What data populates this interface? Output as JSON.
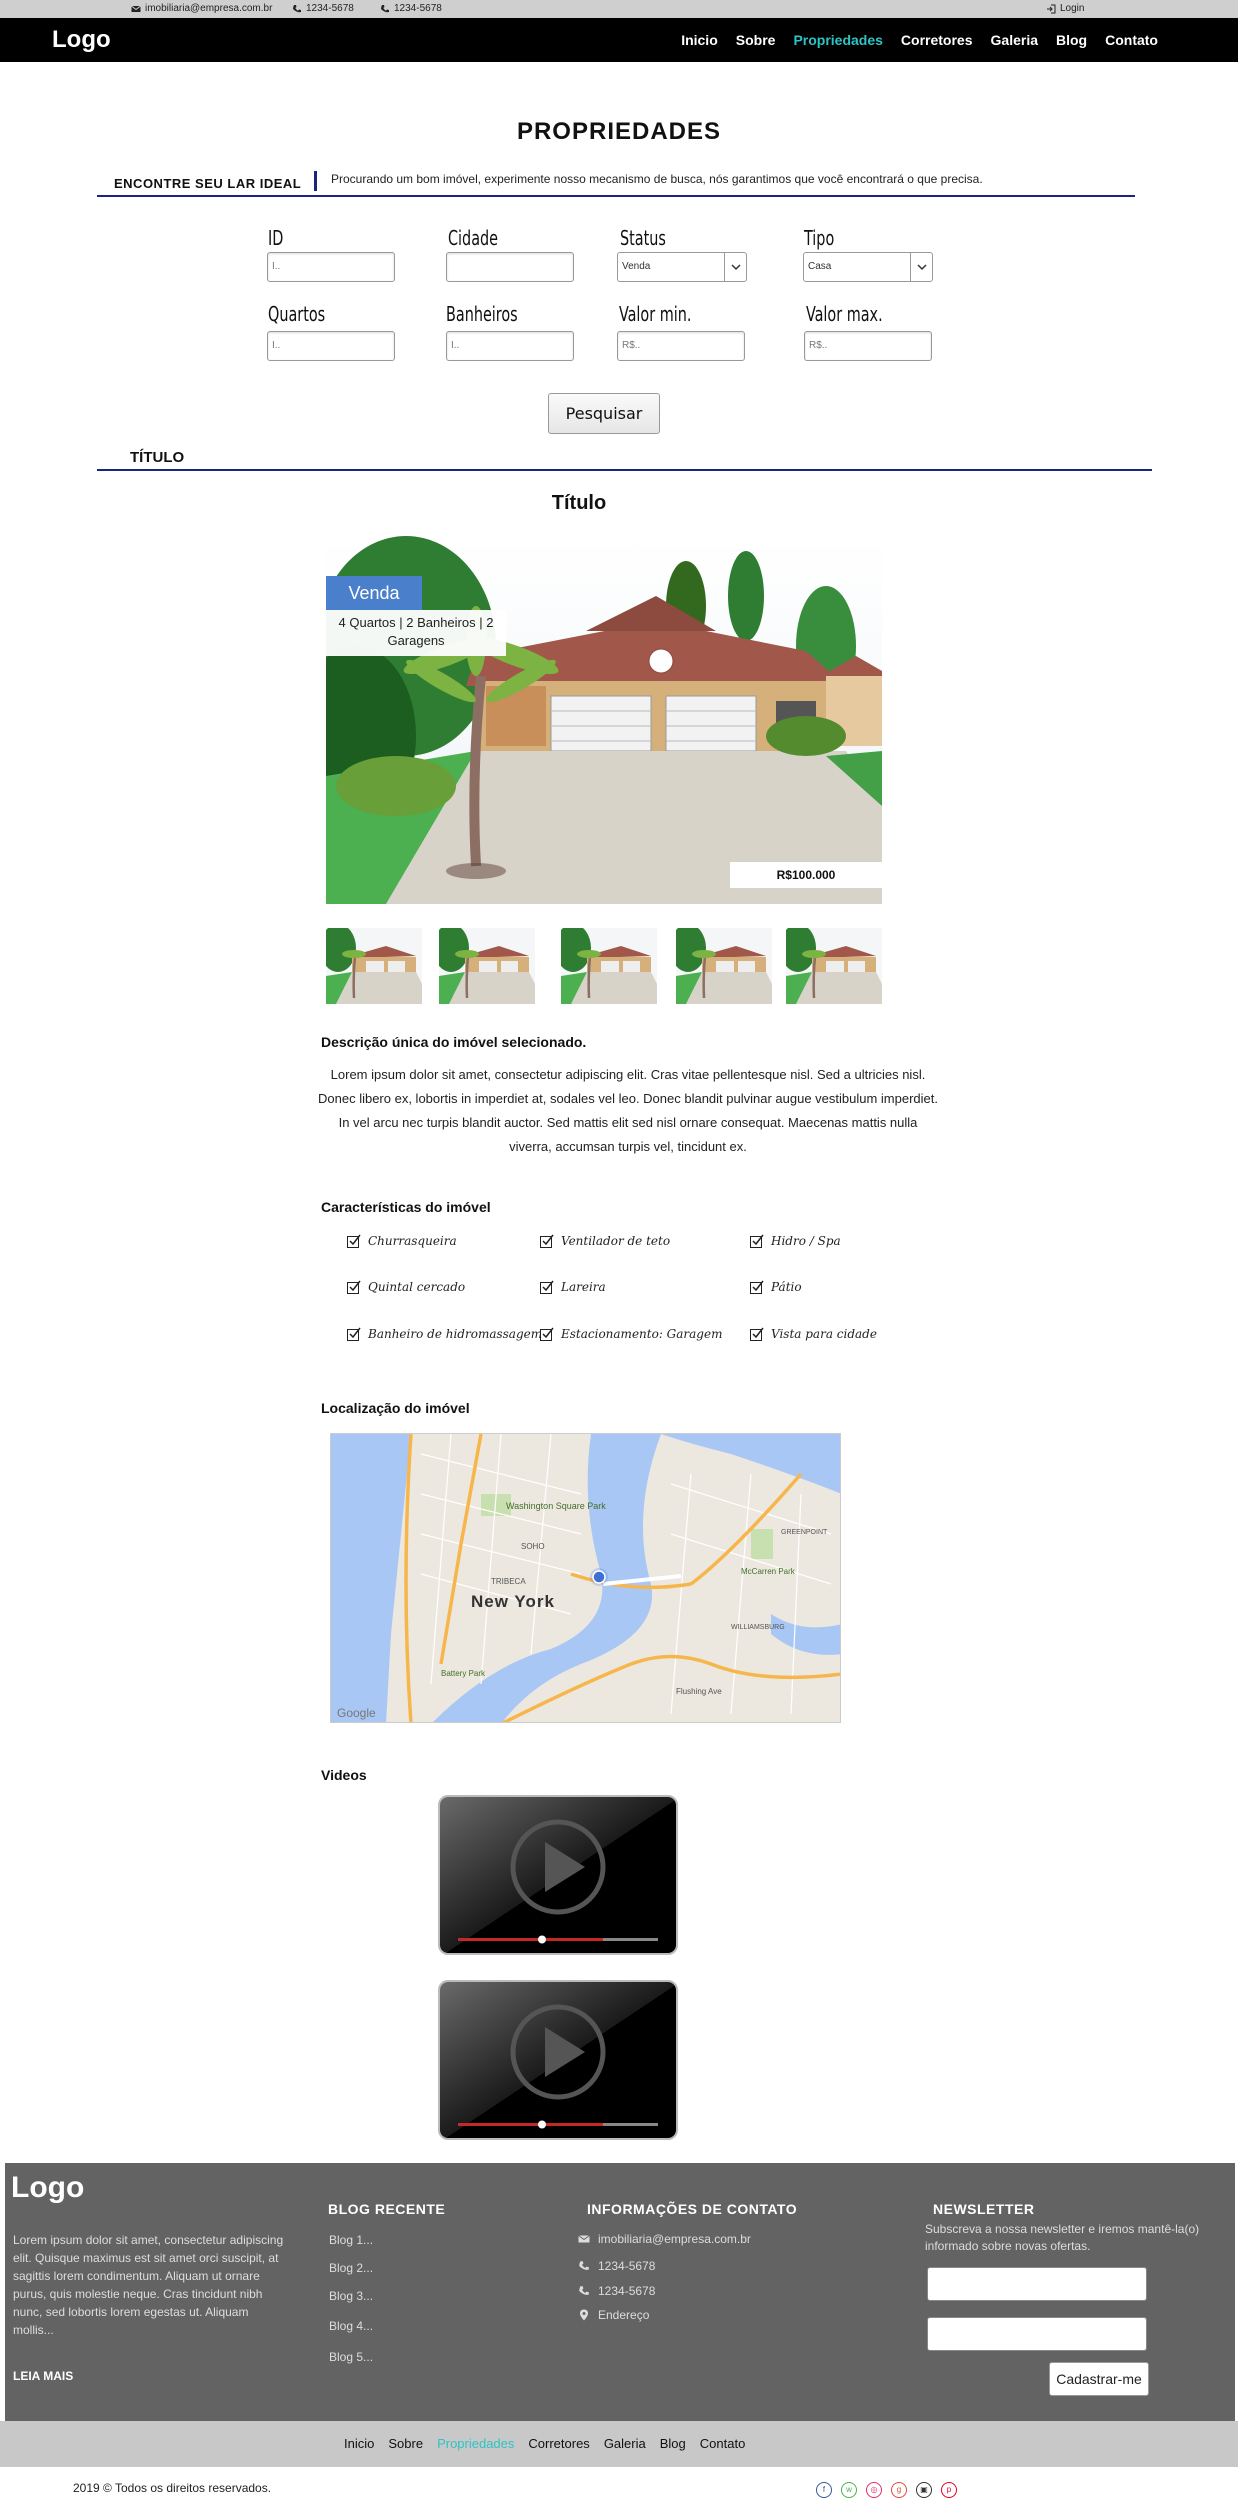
{
  "topbar": {
    "email": "imobiliaria@empresa.com.br",
    "phone1": "1234-5678",
    "phone2": "1234-5678",
    "login": "Login"
  },
  "header": {
    "logo": "Logo",
    "nav": [
      "Inicio",
      "Sobre",
      "Propriedades",
      "Corretores",
      "Galeria",
      "Blog",
      "Contato"
    ],
    "active_nav": "Propriedades"
  },
  "page": {
    "title": "PROPRIEDADES",
    "finder_label": "ENCONTRE SEU LAR IDEAL",
    "finder_text": "Procurando um bom imóvel, experimente nosso mecanismo de busca, nós garantimos que você encontrará o que precisa."
  },
  "search": {
    "id_label": "ID",
    "id_placeholder": "I..",
    "cidade_label": "Cidade",
    "cidade_placeholder": "",
    "status_label": "Status",
    "status_value": "Venda",
    "tipo_label": "Tipo",
    "tipo_value": "Casa",
    "quartos_label": "Quartos",
    "quartos_placeholder": "I..",
    "banheiros_label": "Banheiros",
    "banheiros_placeholder": "I..",
    "valor_min_label": "Valor min.",
    "valor_min_placeholder": "R$..",
    "valor_max_label": "Valor max.",
    "valor_max_placeholder": "R$..",
    "button": "Pesquisar"
  },
  "listing": {
    "section_label": "TÍTULO",
    "title": "Título",
    "status_badge": "Venda",
    "features": "4 Quartos | 2 Banheiros | 2 Garagens",
    "price": "R$100.000",
    "desc_title": "Descrição única do imóvel selecionado.",
    "desc_text": "Lorem ipsum dolor sit amet, consectetur adipiscing elit. Cras vitae pellentesque nisl. Sed a ultricies nisl. Donec libero ex, lobortis in imperdiet at, sodales vel leo. Donec blandit pulvinar augue vestibulum imperdiet. In vel arcu nec turpis blandit auctor. Sed mattis elit sed nisl ornare consequat. Maecenas mattis nulla viverra, accumsan turpis vel, tincidunt ex.",
    "characteristics_title": "Características do imóvel",
    "characteristics": [
      "Churrasqueira",
      "Ventilador de teto",
      "Hidro / Spa",
      "Quintal cercado",
      "Lareira",
      "Pátio",
      "Banheiro de hidromassagem",
      "Estacionamento: Garagem",
      "Vista para cidade"
    ],
    "location_title": "Localização do imóvel",
    "map_labels": {
      "city": "New York",
      "park": "Washington Square Park",
      "soho": "SOHO",
      "tribeca": "TRIBECA",
      "battery": "Battery Park",
      "mccarren": "McCarren Park",
      "williamsburg": "WILLIAMSBURG",
      "greenpoint": "GREENPOINT",
      "flushing": "Flushing Ave",
      "google": "Google"
    },
    "videos_title": "Videos"
  },
  "footer": {
    "logo": "Logo",
    "about": "Lorem ipsum dolor sit amet, consectetur adipiscing elit. Quisque maximus est sit amet orci suscipit, at sagittis lorem condimentum. Aliquam ut ornare purus, quis molestie neque. Cras tincidunt nibh nunc, sed lobortis lorem egestas ut. Aliquam mollis...",
    "read_more": "LEIA MAIS",
    "blog_heading": "BLOG RECENTE",
    "blog_links": [
      "Blog 1...",
      "Blog 2...",
      "Blog 3...",
      "Blog 4...",
      "Blog 5..."
    ],
    "contact_heading": "INFORMAÇÕES DE CONTATO",
    "contact_email": "imobiliaria@empresa.com.br",
    "contact_phone1": "1234-5678",
    "contact_phone2": "1234-5678",
    "contact_address": "Endereço",
    "newsletter_heading": "NEWSLETTER",
    "newsletter_text": "Subscreva a nossa newsletter e iremos mantê-la(o) informado sobre novas ofertas.",
    "newsletter_button": "Cadastrar-me",
    "subnav": [
      "Inicio",
      "Sobre",
      "Propriedades",
      "Corretores",
      "Galeria",
      "Blog",
      "Contato"
    ],
    "copyright": "2019 © Todos os direitos reservados."
  },
  "colors": {
    "accent": "#2ec4c4",
    "rule": "#1a237e",
    "badge": "#4a7fcb",
    "footer": "#636363"
  }
}
